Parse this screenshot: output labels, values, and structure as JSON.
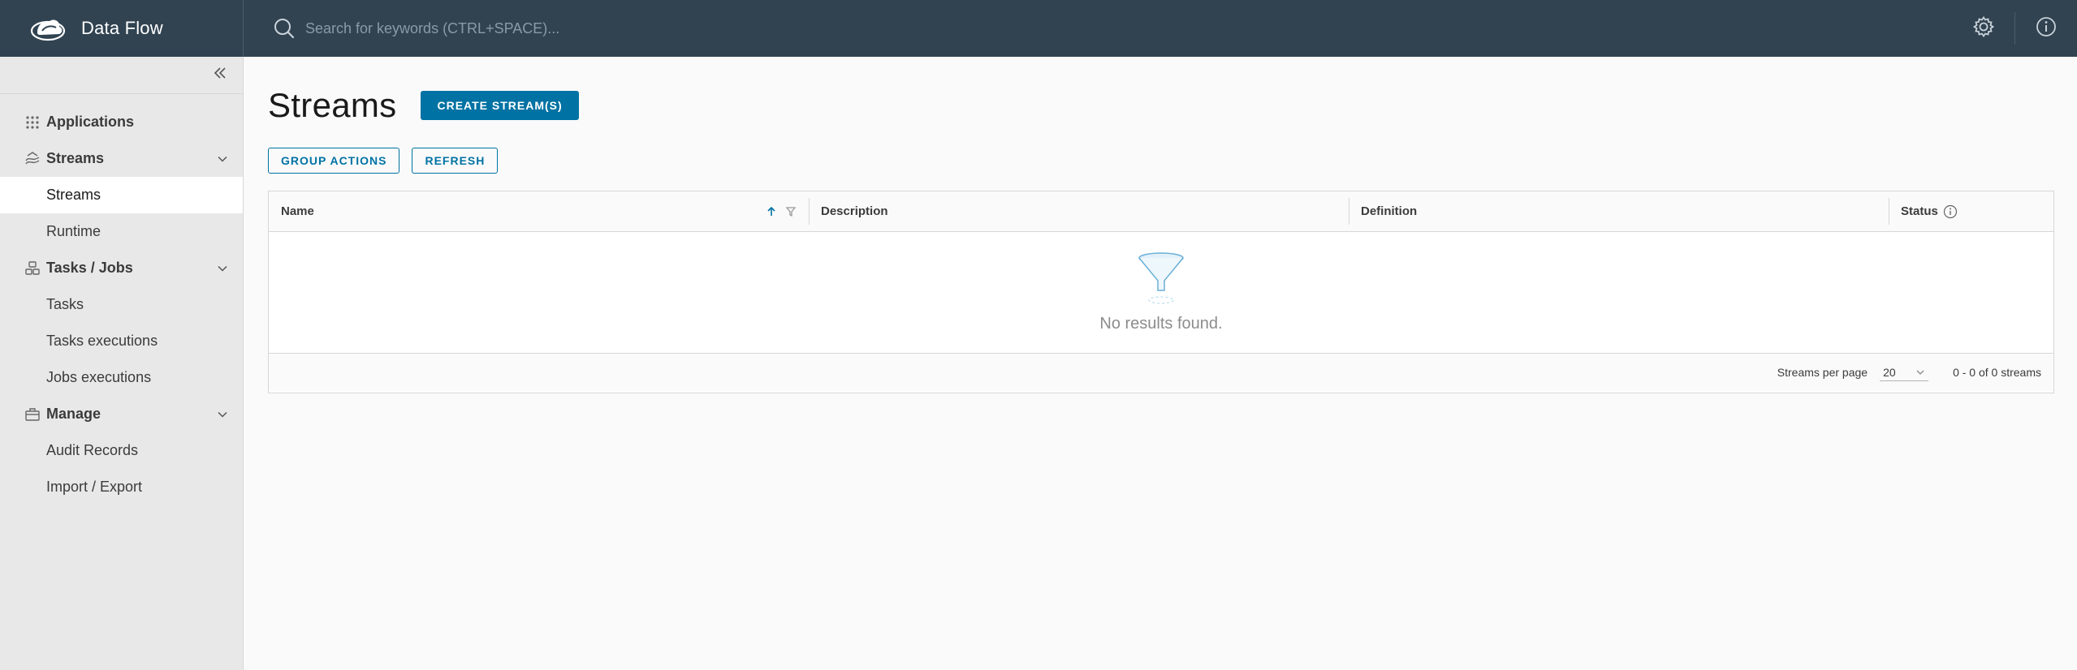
{
  "app": {
    "title": "Data Flow"
  },
  "search": {
    "placeholder": "Search for keywords (CTRL+SPACE)..."
  },
  "header": {
    "icons": [
      "settings-icon",
      "info-icon"
    ]
  },
  "sidebar": {
    "collapse_icon": "double-chevron-left-icon",
    "groups": [
      {
        "label": "Applications",
        "icon": "grid-dots-icon",
        "items": []
      },
      {
        "label": "Streams",
        "icon": "streams-icon",
        "expanded": true,
        "items": [
          "Streams",
          "Runtime"
        ]
      },
      {
        "label": "Tasks / Jobs",
        "icon": "tasks-icon",
        "expanded": true,
        "items": [
          "Tasks",
          "Tasks executions",
          "Jobs executions"
        ]
      },
      {
        "label": "Manage",
        "icon": "toolbox-icon",
        "expanded": true,
        "items": [
          "Audit Records",
          "Import / Export"
        ]
      }
    ],
    "active_item": "Streams"
  },
  "main": {
    "title": "Streams",
    "create_label": "CREATE STREAM(S)",
    "group_actions_label": "GROUP ACTIONS",
    "refresh_label": "REFRESH",
    "table": {
      "columns": [
        "Name",
        "Description",
        "Definition",
        "Status"
      ],
      "sort": "ascending",
      "empty_text": "No results found.",
      "per_page_label": "Streams per page",
      "per_page_value": "20",
      "range_text": "0 - 0 of 0 streams"
    }
  },
  "colors": {
    "header_bg": "#314351",
    "primary": "#0072a3",
    "sidebar_bg": "#e8e8e8"
  }
}
